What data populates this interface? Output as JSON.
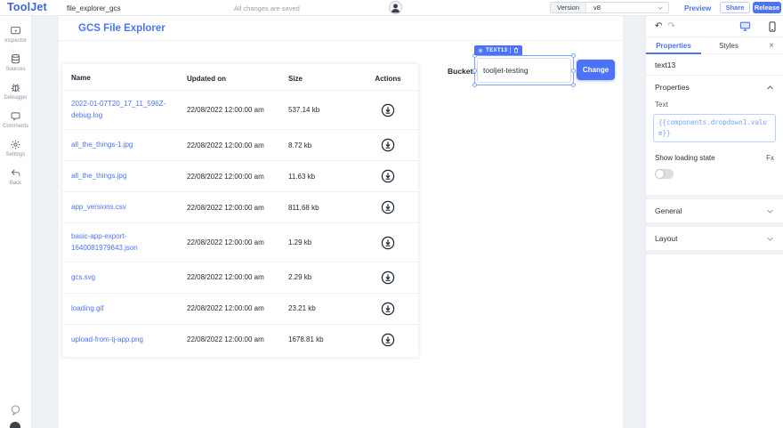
{
  "topbar": {
    "logo": "ToolJet",
    "app_name": "file_explorer_gcs",
    "save_status": "All changes are saved",
    "version_label": "Version",
    "version_value": "v8",
    "preview_label": "Preview",
    "share_label": "Share",
    "release_label": "Release"
  },
  "left_sidebar": {
    "items": [
      {
        "label": "Inspector",
        "icon": "inspector-icon"
      },
      {
        "label": "Sources",
        "icon": "database-icon"
      },
      {
        "label": "Debugger",
        "icon": "bug-icon"
      },
      {
        "label": "Comments",
        "icon": "comment-icon"
      },
      {
        "label": "Settings",
        "icon": "gear-icon"
      },
      {
        "label": "Back",
        "icon": "back-arrow-icon"
      }
    ],
    "bottom_icons": [
      {
        "icon": "help-chat-icon"
      },
      {
        "icon": "dark-mode-icon"
      }
    ]
  },
  "canvas": {
    "page_title": "GCS File Explorer",
    "bucket": {
      "label": "Bucket:",
      "value": "tooljet-testing",
      "widget_badge": "TEXT13",
      "badge_icons": [
        "gear-icon",
        "trash-icon"
      ],
      "change_button": "Change"
    },
    "table": {
      "columns": [
        "Name",
        "Updated on",
        "Size",
        "Actions"
      ],
      "rows": [
        {
          "name": "2022-01-07T20_17_11_596Z-debug.log",
          "updated_on": "22/08/2022 12:00:00 am",
          "size": "537.14 kb",
          "action_icon": "download-icon"
        },
        {
          "name": "all_the_things-1.jpg",
          "updated_on": "22/08/2022 12:00:00 am",
          "size": "8.72 kb",
          "action_icon": "download-icon"
        },
        {
          "name": "all_the_things.jpg",
          "updated_on": "22/08/2022 12:00:00 am",
          "size": "11.63 kb",
          "action_icon": "download-icon"
        },
        {
          "name": "app_versions.csv",
          "updated_on": "22/08/2022 12:00:00 am",
          "size": "811.68 kb",
          "action_icon": "download-icon"
        },
        {
          "name": "basic-app-export-1640081979643.json",
          "updated_on": "22/08/2022 12:00:00 am",
          "size": "1.29 kb",
          "action_icon": "download-icon"
        },
        {
          "name": "gcs.svg",
          "updated_on": "22/08/2022 12:00:00 am",
          "size": "2.29 kb",
          "action_icon": "download-icon"
        },
        {
          "name": "loading.gif",
          "updated_on": "22/08/2022 12:00:00 am",
          "size": "23.21 kb",
          "action_icon": "download-icon"
        },
        {
          "name": "upload-from-tj-app.png",
          "updated_on": "22/08/2022 12:00:00 am",
          "size": "1678.81 kb",
          "action_icon": "download-icon"
        }
      ]
    }
  },
  "right_panel": {
    "undo_glyph": "↶",
    "redo_glyph": "↷",
    "view_icons": [
      "desktop-icon",
      "mobile-icon"
    ],
    "tabs": [
      {
        "label": "Properties",
        "active": true
      },
      {
        "label": "Styles",
        "active": false
      }
    ],
    "close_glyph": "×",
    "widget_name": "text13",
    "properties_section": {
      "title": "Properties",
      "text_label": "Text",
      "text_value": "{{components.dropdown1.value}}",
      "show_loading_label": "Show loading state",
      "fx_label": "Fx",
      "loading_enabled": false
    },
    "general_section": "General",
    "layout_section": "Layout"
  },
  "colors": {
    "primary": "#4d72fa",
    "logo_blue": "#3e63dd",
    "code_text": "#74a2f6",
    "canvas_bg": "#eef1f6"
  }
}
